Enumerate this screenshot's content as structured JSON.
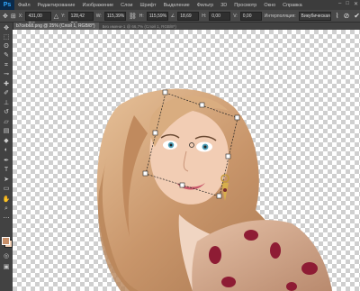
{
  "app": {
    "logo": "Ps"
  },
  "menu": {
    "items": [
      "Файл",
      "Редактирование",
      "Изображение",
      "Слои",
      "Шрифт",
      "Выделение",
      "Фильтр",
      "3D",
      "Просмотр",
      "Окно",
      "Справка"
    ]
  },
  "window_controls": {
    "minimize": "–",
    "maximize": "□",
    "close": "✕"
  },
  "options": {
    "x_label": "X:",
    "x_value": "431,00 пкс",
    "y_label": "Y:",
    "y_value": "128,42 пкс",
    "w_label": "W:",
    "w_value": "115,39%",
    "h_label": "H:",
    "h_value": "115,59%",
    "angle_label": "∠",
    "angle_value": "18,69",
    "h_skew_label": "H:",
    "h_skew_value": "0,00",
    "v_skew_label": "V:",
    "v_skew_value": "0,00",
    "interp_label": "Интерполяция:",
    "interp_value": "Бикубическая"
  },
  "document": {
    "tab_title": "b7ceb68.png @ 25% (Слой 1, RGB/8*)",
    "tab_extra": "Без имени-1 @ 66,7% (Слой 1, RGB/8*)"
  },
  "colors": {
    "foreground": "#c8906a",
    "background": "#f3d2b8",
    "ui_dark": "#3c3c3c",
    "accent": "#31a8ff"
  },
  "tools": [
    "move-tool",
    "marquee-tool",
    "lasso-tool",
    "quick-select-tool",
    "crop-tool",
    "eyedropper-tool",
    "healing-tool",
    "brush-tool",
    "clone-stamp-tool",
    "history-brush-tool",
    "eraser-tool",
    "gradient-tool",
    "blur-tool",
    "dodge-tool",
    "pen-tool",
    "type-tool",
    "path-select-tool",
    "shape-tool",
    "hand-tool",
    "zoom-tool"
  ]
}
